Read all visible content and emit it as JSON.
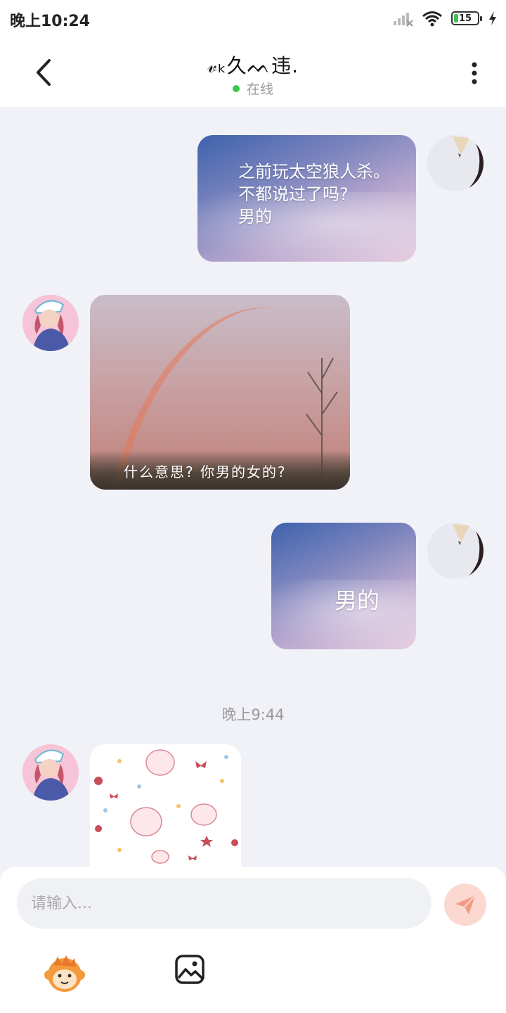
{
  "status_bar": {
    "time": "晚上10:24",
    "battery": "15",
    "icons": [
      "signal-icon",
      "wifi-icon",
      "battery-icon",
      "charging-icon"
    ]
  },
  "header": {
    "title": "𝓋ₖ久ᨓ违.",
    "status": "在线",
    "icons": [
      "back-arrow-icon",
      "more-vertical-icon"
    ]
  },
  "messages": [
    {
      "sender": "self",
      "type": "image",
      "text": "之前玩太空狼人杀。\n不都说过了吗?\n男的"
    },
    {
      "sender": "other",
      "type": "image",
      "text": "什么意思? 你男的女的?"
    },
    {
      "sender": "self",
      "type": "image",
      "text": "男的"
    },
    {
      "sender": "other",
      "type": "sticker",
      "text": ""
    }
  ],
  "timestamp": "晚上9:44",
  "input": {
    "placeholder": "请输入...",
    "value": ""
  },
  "toolbar": {
    "icons": [
      "monkey-emoji-icon",
      "image-gallery-icon",
      "send-plane-icon"
    ]
  },
  "colors": {
    "background": "#f1f2f8",
    "online": "#3bc84a",
    "send_button": "#fbd9d0",
    "send_icon": "#f29a86"
  }
}
